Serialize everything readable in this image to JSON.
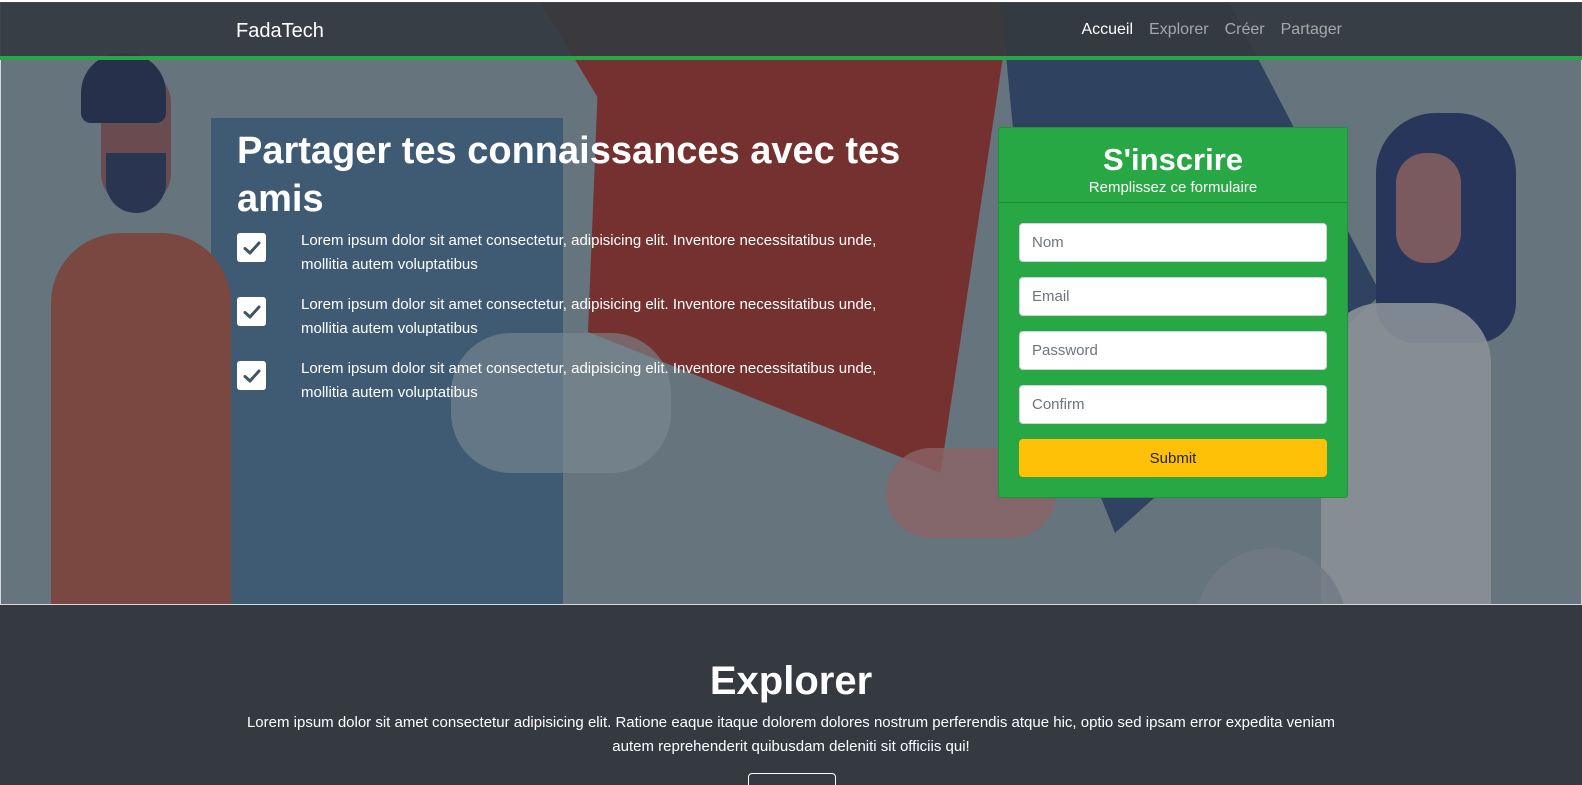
{
  "navbar": {
    "brand": "FadaTech",
    "links": [
      {
        "label": "Accueil",
        "active": true
      },
      {
        "label": "Explorer",
        "active": false
      },
      {
        "label": "Créer",
        "active": false
      },
      {
        "label": "Partager",
        "active": false
      }
    ]
  },
  "hero": {
    "title": "Partager tes connaissances avec tes amis",
    "features": [
      {
        "icon": "check-icon",
        "text": "Lorem ipsum dolor sit amet consectetur, adipisicing elit. Inventore necessitatibus unde, mollitia autem voluptatibus"
      },
      {
        "icon": "check-icon",
        "text": "Lorem ipsum dolor sit amet consectetur, adipisicing elit. Inventore necessitatibus unde, mollitia autem voluptatibus"
      },
      {
        "icon": "check-icon",
        "text": "Lorem ipsum dolor sit amet consectetur, adipisicing elit. Inventore necessitatibus unde, mollitia autem voluptatibus"
      }
    ]
  },
  "signup": {
    "title": "S'inscrire",
    "subtitle": "Remplissez ce formulaire",
    "fields": {
      "name_placeholder": "Nom",
      "email_placeholder": "Email",
      "password_placeholder": "Password",
      "confirm_placeholder": "Confirm"
    },
    "submit_label": "Submit"
  },
  "explore": {
    "title": "Explorer",
    "text": "Lorem ipsum dolor sit amet consectetur adipisicing elit. Ratione eaque itaque dolorem dolores nostrum perferendis atque hic, optio sed ipsam error expedita veniam autem reprehenderit quibusdam deleniti sit officiis qui!"
  },
  "colors": {
    "navbar": "#343a40",
    "accent_green": "#28a745",
    "button_yellow": "#ffc107"
  }
}
